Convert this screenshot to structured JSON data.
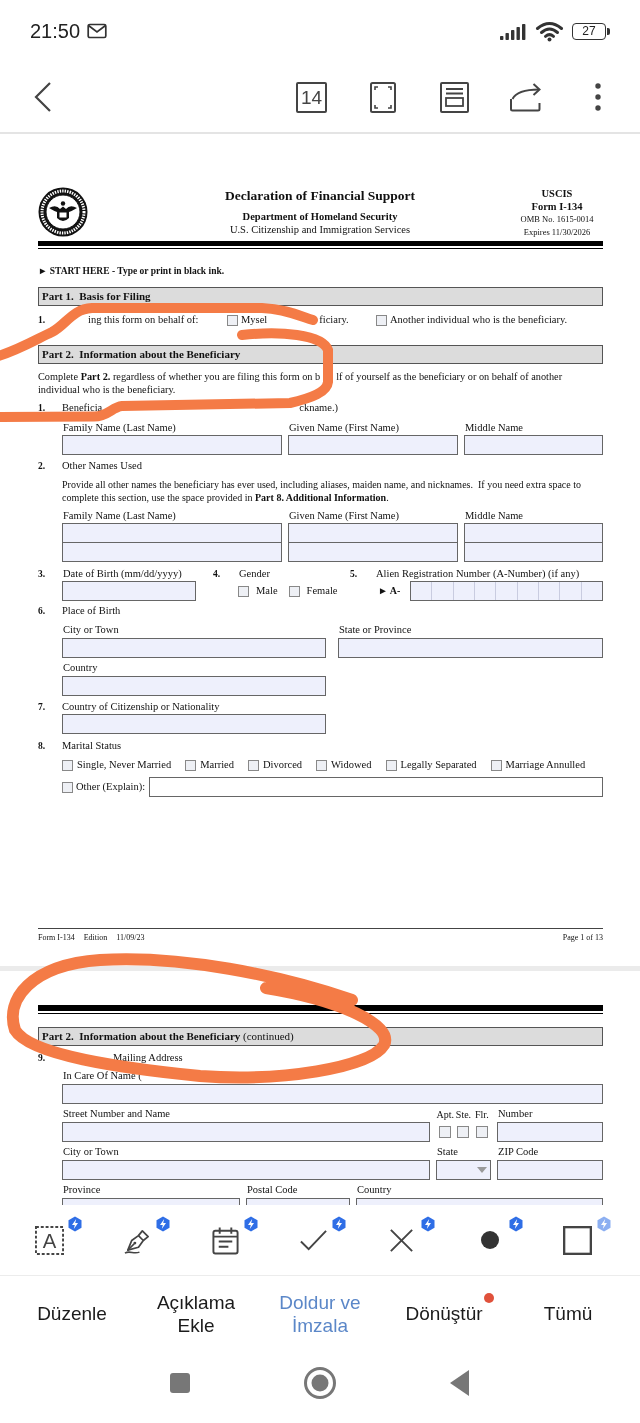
{
  "status_bar": {
    "time": "21:50",
    "battery": "27"
  },
  "top_bar": {
    "page_count": "14"
  },
  "page_1": {
    "header": {
      "title": "Declaration of Financial Support",
      "department": "Department of Homeland Security",
      "agency": "U.S. Citizenship and Immigration Services",
      "form_info": [
        "USCIS",
        "Form I-134",
        "OMB No. 1615-0014",
        "Expires 11/30/2026"
      ]
    },
    "instruction": "► START HERE - Type or print in black ink.",
    "part_1": {
      "heading": "Part 1.  Basis for Filing",
      "number": "1.",
      "prompt": "ing this form on behalf of:",
      "options": [
        {
          "label_parts": [
            "Mysel",
            "ficiary."
          ],
          "checked": false
        },
        {
          "label_parts": [
            "Another individual who is the beneficiary."
          ],
          "checked": false
        }
      ]
    },
    "part_2": {
      "heading": "Part 2.  Information about the Beneficiary",
      "intro_parts": [
        "Complete **Part 2.** regardless of whether you are filing this form on b",
        "lf of yourself as the beneficiary or on behalf of another individual who is the beneficiary."
      ],
      "items": [
        {
          "kind": "full_name",
          "number": "1.",
          "label_parts": [
            "Beneficia",
            "ckname.)"
          ],
          "columns": [
            "Family Name (Last Name)",
            "Given Name (First Name)",
            "Middle Name"
          ]
        },
        {
          "kind": "other_names",
          "number": "2.",
          "label_parts": [
            "Other Names Used"
          ],
          "note": "Provide all other names the beneficiary has ever used, including aliases, maiden name, and nicknames.  If you need extra space to complete this section, use the space provided in **Part 8. Additional Information**.",
          "columns": [
            "Family Name (Last Name)",
            "Given Name (First Name)",
            "Middle Name"
          ]
        },
        {
          "kind": "birth_row",
          "cells": [
            {
              "kind": "date",
              "number": "3.",
              "label": "Date of Birth (mm/dd/yyyy)"
            },
            {
              "kind": "choices",
              "number": "4.",
              "label": "Gender",
              "options": [
                {
                  "label": "Male",
                  "checked": false
                },
                {
                  "label": "Female",
                  "checked": false
                }
              ]
            },
            {
              "kind": "a_number",
              "number": "5.",
              "label": "Alien Registration Number (A-Number) (if any)",
              "prefix": "► A-"
            }
          ]
        },
        {
          "kind": "fields",
          "number": "6.",
          "label_parts": [
            "Place of Birth"
          ],
          "rows": [
            [
              {
                "kind": "text",
                "label": "City or Town"
              },
              {
                "kind": "text",
                "label": "State or Province"
              }
            ],
            [
              {
                "kind": "text",
                "label": "Country"
              }
            ]
          ]
        },
        {
          "kind": "single_field",
          "number": "7.",
          "label_parts": [
            "Country of Citizenship or Nationality"
          ]
        },
        {
          "kind": "checklist",
          "number": "8.",
          "label_parts": [
            "Marital Status"
          ],
          "options": [
            {
              "kind": "plain",
              "label": "Single, Never Married",
              "checked": false
            },
            {
              "kind": "plain",
              "label": "Married",
              "checked": false
            },
            {
              "kind": "plain",
              "label": "Divorced",
              "checked": false
            },
            {
              "kind": "plain",
              "label": "Widowed",
              "checked": false
            },
            {
              "kind": "plain",
              "label": "Legally Separated",
              "checked": false
            },
            {
              "kind": "plain",
              "label": "Marriage Annulled",
              "checked": false
            },
            {
              "kind": "explain",
              "label": "Other (Explain):",
              "checked": false
            }
          ]
        }
      ]
    },
    "footer": {
      "form": "Form I-134",
      "edition": "Edition",
      "date": "11/09/23",
      "page": "Page 1 of 13"
    }
  },
  "page_2": {
    "heading": {
      "title": "Part 2.  Information about the Beneficiary",
      "suffix": "(continued)"
    },
    "items": [
      {
        "kind": "address",
        "number": "9.",
        "label_parts": [
          "Mailing Address"
        ],
        "rows": [
          [
            {
              "kind": "text",
              "label": "In Care Of Name ("
            }
          ],
          [
            {
              "kind": "text",
              "label": "Street Number and Name"
            },
            {
              "kind": "unit_type",
              "options": [
                {
                  "label": "Apt.",
                  "checked": false
                },
                {
                  "label": "Ste.",
                  "checked": false
                },
                {
                  "label": "Flr.",
                  "checked": false
                }
              ]
            },
            {
              "kind": "text",
              "label": "Number"
            }
          ],
          [
            {
              "kind": "text",
              "label": "City or Town"
            },
            {
              "kind": "select",
              "label": "State"
            },
            {
              "kind": "text",
              "label": "ZIP Code"
            }
          ],
          [
            {
              "kind": "text",
              "label": "Province"
            },
            {
              "kind": "text",
              "label": "Postal Code"
            },
            {
              "kind": "text",
              "label": "Country"
            }
          ]
        ]
      }
    ]
  },
  "tools": [
    {
      "kind": "text_box",
      "label": "A",
      "badge_faded": false
    },
    {
      "kind": "signature",
      "badge_faded": false
    },
    {
      "kind": "date",
      "badge_faded": false
    },
    {
      "kind": "check",
      "badge_faded": false
    },
    {
      "kind": "cross",
      "badge_faded": false
    },
    {
      "kind": "dot",
      "badge_faded": false
    },
    {
      "kind": "rectangle",
      "badge_faded": true
    }
  ],
  "tabs": [
    {
      "label": "Düzenle",
      "selected": false,
      "badge": false
    },
    {
      "label": "Açıklama Ekle",
      "selected": false,
      "badge": false
    },
    {
      "label": "Doldur ve İmzala",
      "selected": true,
      "badge": false
    },
    {
      "label": "Dönüştür",
      "selected": false,
      "badge": true
    },
    {
      "label": "Tümü",
      "selected": false,
      "badge": false
    }
  ]
}
